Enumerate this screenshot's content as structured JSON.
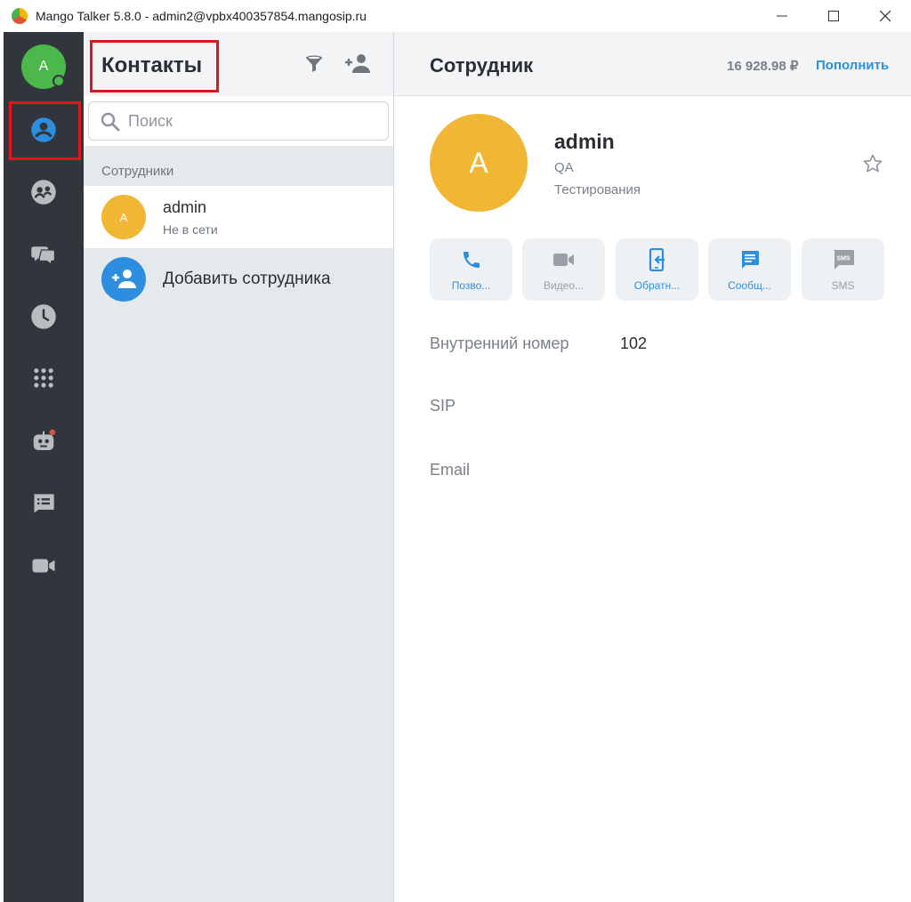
{
  "window": {
    "title": "Mango Talker 5.8.0 - admin2@vpbx400357854.mangosip.ru"
  },
  "rail": {
    "avatar_initial": "A",
    "items": [
      {
        "icon": "contacts-icon",
        "active": true
      },
      {
        "icon": "groups-icon",
        "active": false
      },
      {
        "icon": "chats-icon",
        "active": false
      },
      {
        "icon": "history-icon",
        "active": false
      },
      {
        "icon": "dialpad-icon",
        "active": false
      },
      {
        "icon": "bot-icon",
        "active": false
      },
      {
        "icon": "tasks-icon",
        "active": false
      },
      {
        "icon": "video-conference-icon",
        "active": false
      }
    ]
  },
  "contacts": {
    "title": "Контакты",
    "search_placeholder": "Поиск",
    "section_label": "Сотрудники",
    "list": [
      {
        "initial": "A",
        "name": "admin",
        "status": "Не в сети"
      }
    ],
    "add_label": "Добавить сотрудника"
  },
  "detail": {
    "title": "Сотрудник",
    "balance": "16 928.98 ₽",
    "topup_label": "Пополнить",
    "profile": {
      "initial": "A",
      "name": "admin",
      "department": "QA",
      "group": "Тестирования"
    },
    "actions": [
      {
        "label": "Позво...",
        "icon": "phone-icon",
        "enabled": true
      },
      {
        "label": "Видео...",
        "icon": "video-icon",
        "enabled": false
      },
      {
        "label": "Обратн...",
        "icon": "callback-icon",
        "enabled": true
      },
      {
        "label": "Сообщ...",
        "icon": "message-icon",
        "enabled": true
      },
      {
        "label": "SMS",
        "icon": "sms-icon",
        "enabled": false
      }
    ],
    "fields": [
      {
        "label": "Внутренний номер",
        "value": "102"
      },
      {
        "label": "SIP",
        "value": ""
      },
      {
        "label": "Email",
        "value": ""
      }
    ]
  },
  "colors": {
    "accent": "#2d8ee0",
    "rail_bg": "#31363d",
    "avatar_yellow": "#f1b634",
    "online_green": "#4cb84c",
    "highlight_red": "#e0151d"
  }
}
